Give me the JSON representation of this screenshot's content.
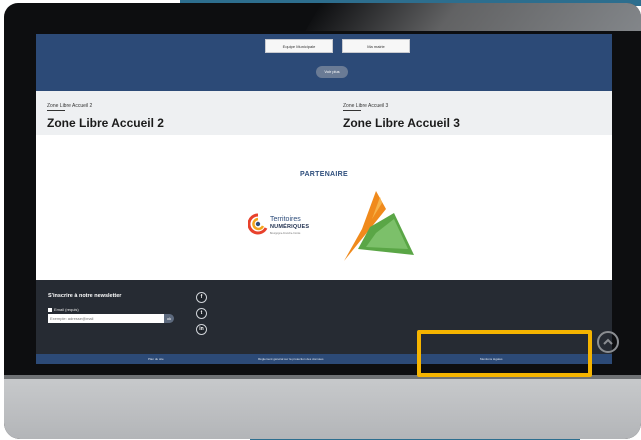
{
  "hero": {
    "buttons": [
      "Equipe Municipale",
      "Ma mairie"
    ],
    "voir_plus": "Voir plus"
  },
  "zones": [
    {
      "small": "Zone Libre Accueil 2",
      "big": "Zone Libre Accueil 2"
    },
    {
      "small": "Zone Libre Accueil 3",
      "big": "Zone Libre Accueil 3"
    }
  ],
  "partners": {
    "title": "PARTENAIRE",
    "logo1_line1": "Territoires",
    "logo1_line2": "NUMÉRIQUES",
    "logo1_line3": "Bourgogne-Franche-Comté"
  },
  "newsletter": {
    "title": "S'inscrire à notre newsletter",
    "label": "Email (requis)",
    "placeholder": "Exemple: adresse@mail",
    "send": "ok"
  },
  "social": [
    "f",
    "t",
    "in"
  ],
  "bottom_links": [
    "Plan du site",
    "Règlement général sur la protection des données",
    "Mentions légales"
  ],
  "colors": {
    "hero_blue": "#2c4a77",
    "footer_dark": "#262b33",
    "highlight": "#f5b400",
    "orange": "#f08a1c",
    "green": "#5aa646"
  }
}
